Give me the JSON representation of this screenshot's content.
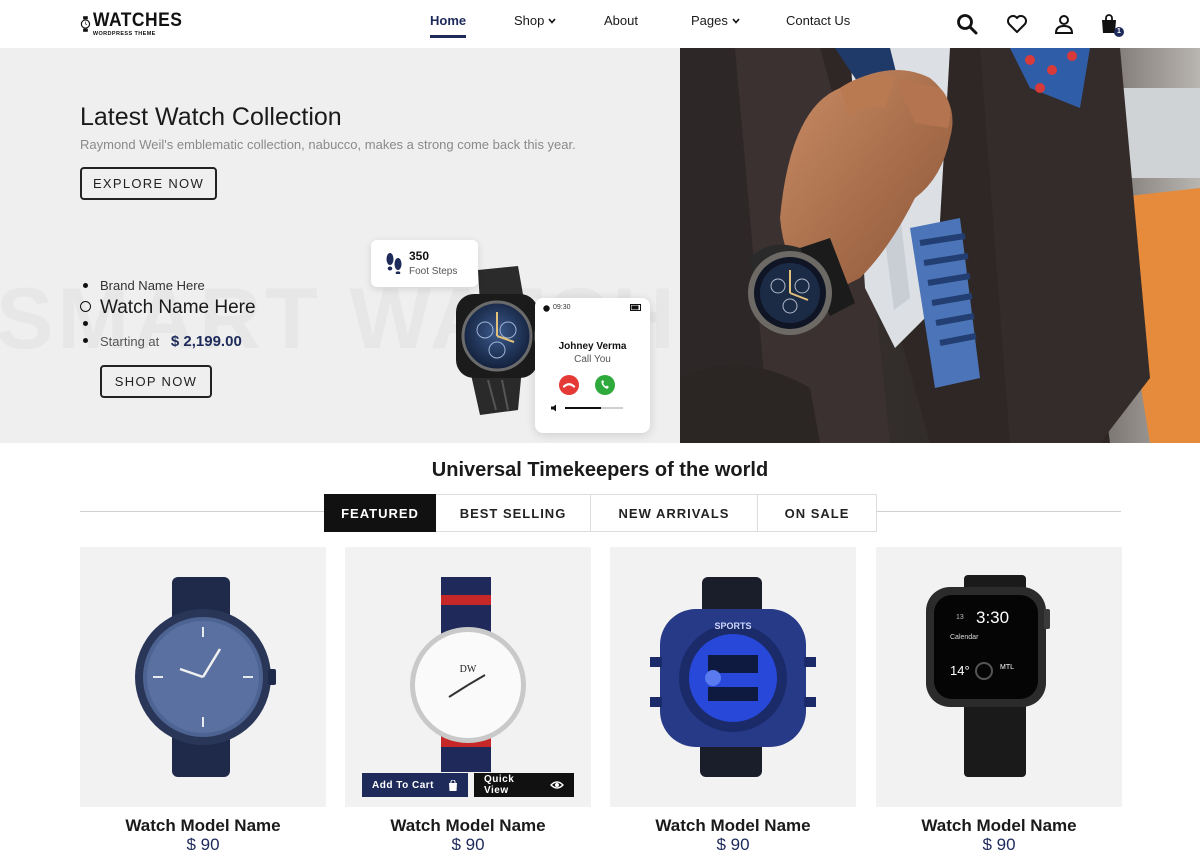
{
  "header": {
    "logo_title": "WATCHES",
    "logo_subtitle": "WORDPRESS THEME",
    "nav": [
      {
        "label": "Home",
        "active": true,
        "dropdown": false
      },
      {
        "label": "Shop",
        "active": false,
        "dropdown": true
      },
      {
        "label": "About",
        "active": false,
        "dropdown": false
      },
      {
        "label": "Pages",
        "active": false,
        "dropdown": true
      },
      {
        "label": "Contact Us",
        "active": false,
        "dropdown": false
      }
    ],
    "icons": [
      "search-icon",
      "heart-icon",
      "user-icon",
      "shopping-bag-icon"
    ],
    "cart_count": "1"
  },
  "hero": {
    "title": "Latest Watch Collection",
    "subtitle": "Raymond Weil's emblematic collection, nabucco, makes a strong come back this year.",
    "explore_label": "EXPLORE NOW",
    "watermark": "SMART WATCH",
    "slide": {
      "brand": "Brand Name Here",
      "name": "Watch Name Here",
      "starting_label": "Starting at",
      "price": "$ 2,199.00",
      "shop_label": "SHOP NOW"
    },
    "steps_card": {
      "count": "350",
      "label": "Foot Steps"
    },
    "call_card": {
      "time": "09:30",
      "name": "Johney Verma",
      "status": "Call You"
    }
  },
  "section": {
    "title": "Universal Timekeepers of the world",
    "tabs": [
      {
        "label": "FEATURED",
        "active": true
      },
      {
        "label": "BEST SELLING",
        "active": false
      },
      {
        "label": "NEW ARRIVALS",
        "active": false
      },
      {
        "label": "ON SALE",
        "active": false
      }
    ]
  },
  "products": [
    {
      "name": "Watch Model Name",
      "price": "$ 90"
    },
    {
      "name": "Watch Model Name",
      "price": "$ 90",
      "add_to_cart": "Add To Cart",
      "quick_view": "Quick View"
    },
    {
      "name": "Watch Model Name",
      "price": "$ 90"
    },
    {
      "name": "Watch Model Name",
      "price": "$ 90"
    }
  ],
  "colors": {
    "accent": "#1d2a5a",
    "dark": "#111111",
    "hero_bg": "#efefef",
    "card_bg": "#f2f2f2"
  }
}
